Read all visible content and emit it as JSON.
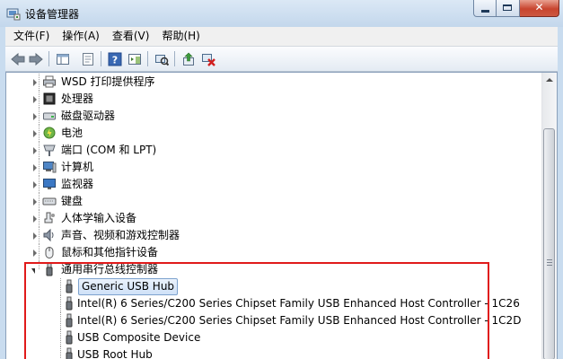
{
  "window": {
    "title": "设备管理器"
  },
  "menubar": {
    "items": [
      "文件(F)",
      "操作(A)",
      "查看(V)",
      "帮助(H)"
    ]
  },
  "tree": {
    "categories": [
      {
        "label": "WSD 打印提供程序",
        "icon": "printer-icon"
      },
      {
        "label": "处理器",
        "icon": "processor-icon"
      },
      {
        "label": "磁盘驱动器",
        "icon": "disk-drive-icon"
      },
      {
        "label": "电池",
        "icon": "battery-icon"
      },
      {
        "label": "端口 (COM 和 LPT)",
        "icon": "port-icon"
      },
      {
        "label": "计算机",
        "icon": "computer-icon"
      },
      {
        "label": "监视器",
        "icon": "monitor-icon"
      },
      {
        "label": "键盘",
        "icon": "keyboard-icon"
      },
      {
        "label": "人体学输入设备",
        "icon": "hid-icon"
      },
      {
        "label": "声音、视频和游戏控制器",
        "icon": "sound-icon"
      },
      {
        "label": "鼠标和其他指针设备",
        "icon": "mouse-icon"
      }
    ],
    "expanded": {
      "label": "通用串行总线控制器",
      "icon": "usb-controller-icon",
      "children": [
        {
          "label": "Generic USB Hub",
          "icon": "usb-icon",
          "selected": true
        },
        {
          "label": "Intel(R) 6 Series/C200 Series Chipset Family USB Enhanced Host Controller - 1C26",
          "icon": "usb-icon"
        },
        {
          "label": "Intel(R) 6 Series/C200 Series Chipset Family USB Enhanced Host Controller - 1C2D",
          "icon": "usb-icon"
        },
        {
          "label": "USB Composite Device",
          "icon": "usb-icon"
        },
        {
          "label": "USB Root Hub",
          "icon": "usb-icon"
        }
      ]
    }
  },
  "colors": {
    "highlight_box": "#e01a1a",
    "selection": "#cfe1f7",
    "titlebar": "#c3d7ec"
  }
}
